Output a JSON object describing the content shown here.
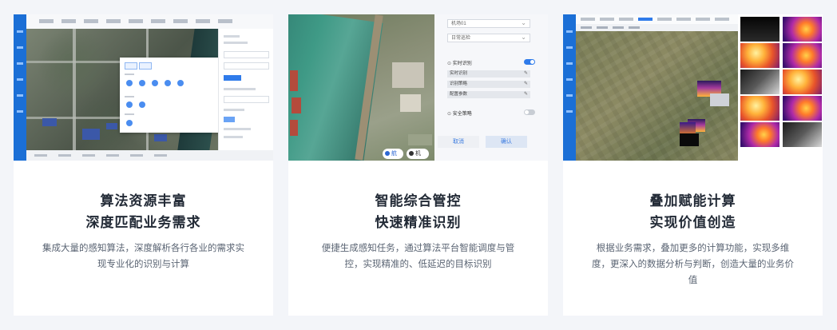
{
  "cards": [
    {
      "title_line1": "算法资源丰富",
      "title_line2": "深度匹配业务需求",
      "description": "集成大量的感知算法，深度解析各行各业的需求实现专业化的识别与计算"
    },
    {
      "title_line1": "智能综合管控",
      "title_line2": "快速精准识别",
      "description": "便捷生成感知任务，通过算法平台智能调度与管控，实现精准的、低延迟的目标识别",
      "panel": {
        "device_select": "机场01",
        "mode_select": "日常巡检",
        "realtime_label": "实时识别",
        "row1": "实时识别",
        "row2": "识别策略",
        "row3": "配置参数",
        "safety_label": "安全策略",
        "cancel_button": "取消",
        "confirm_button": "确认",
        "chip_left": "航线路",
        "chip_right": "机场"
      }
    },
    {
      "title_line1": "叠加赋能计算",
      "title_line2": "实现价值创造",
      "description": "根据业务需求，叠加更多的计算功能，实现多维度，更深入的数据分析与判断，创造大量的业务价值"
    }
  ],
  "colors": {
    "page_bg": "#f3f5f9",
    "card_bg": "#ffffff",
    "title": "#222a36",
    "desc": "#5a6473",
    "accent": "#2f7bea"
  }
}
